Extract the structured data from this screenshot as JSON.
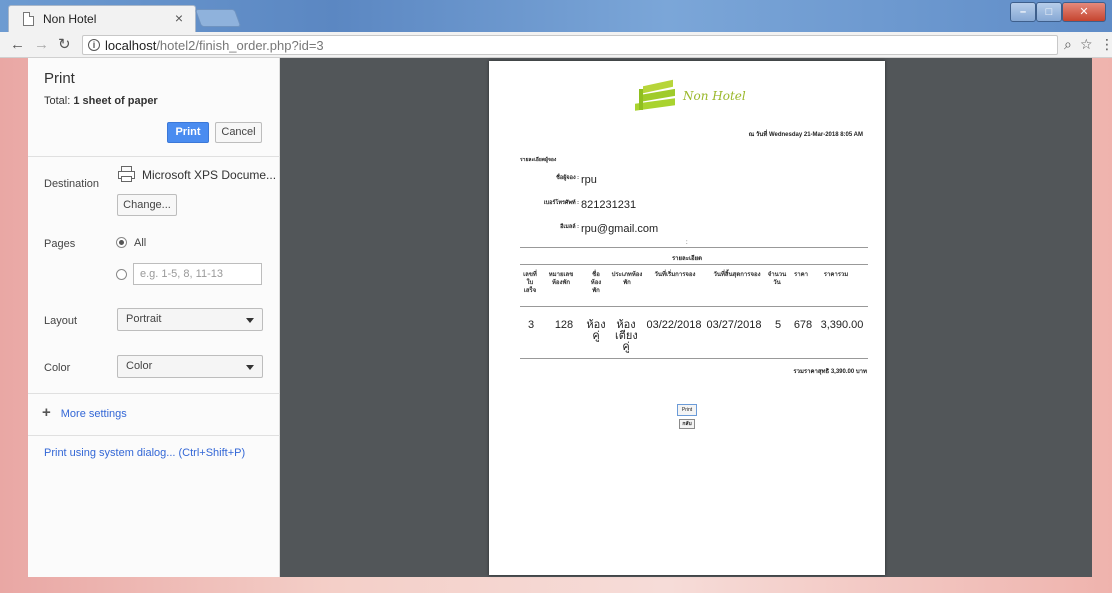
{
  "browser": {
    "tab_title": "Non Hotel",
    "tab_close": "×",
    "url_host": "localhost",
    "url_path": "/hotel2/finish_order.php?id=3",
    "info_icon_glyph": "i"
  },
  "print_panel": {
    "title": "Print",
    "total_prefix": "Total: ",
    "total_bold": "1 sheet of paper",
    "print_button": "Print",
    "cancel_button": "Cancel",
    "destination_label": "Destination",
    "destination_value": "Microsoft XPS Docume...",
    "change_button": "Change...",
    "pages_label": "Pages",
    "pages_all": "All",
    "pages_placeholder": "e.g. 1-5, 8, 11-13",
    "layout_label": "Layout",
    "layout_value": "Portrait",
    "color_label": "Color",
    "color_value": "Color",
    "more_settings": "More settings",
    "system_dialog": "Print using system dialog... (Ctrl+Shift+P)"
  },
  "document": {
    "hotel_name": "Non Hotel",
    "date_line": "ณ วันที่ Wednesday 21-Mar-2018 8:05 AM",
    "section_title": "รายละเอียดผู้จอง",
    "fields": [
      {
        "label": "ชื่อผู้จอง :",
        "value": "rpu"
      },
      {
        "label": "เบอร์โทรศัพท์ :",
        "value": "821231231"
      },
      {
        "label": "อีเมลล์ :",
        "value": "rpu@gmail.com"
      }
    ],
    "colon": ":",
    "detail_title": "รายละเอียด",
    "headers": [
      "เลขที่ใบเสร็จ",
      "หมายเลขห้องพัก",
      "ชื่อห้องพัก",
      "ประเภทห้องพัก",
      "วันที่เริ่มการจอง",
      "วันที่สิ้นสุดการจอง",
      "จำนวนวัน",
      "ราคา",
      "ราคารวม"
    ],
    "row": [
      "3",
      "128",
      "ห้องคู่",
      "ห้องเตียงคู่",
      "03/22/2018",
      "03/27/2018",
      "5",
      "678",
      "3,390.00"
    ],
    "total_line": "รวมราคาสุทธิ 3,390.00 บาท",
    "print_btn": "Print",
    "back_btn": "กลับ"
  }
}
